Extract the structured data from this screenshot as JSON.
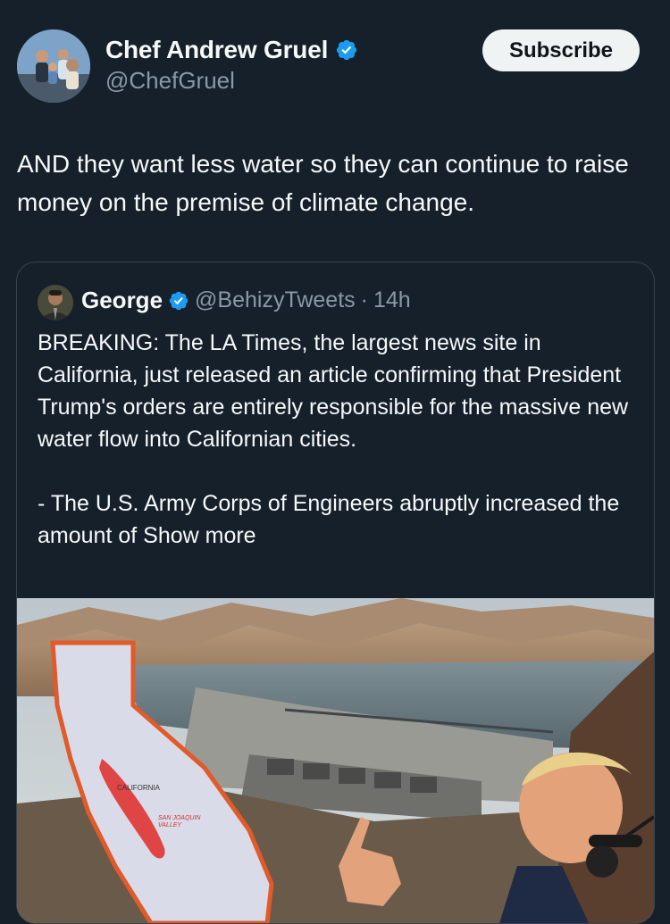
{
  "author": {
    "display_name": "Chef Andrew Gruel",
    "handle": "@ChefGruel",
    "avatar_icon": "family-photo-avatar",
    "verified": true
  },
  "subscribe_label": "Subscribe",
  "tweet": {
    "text": "AND they want less water so they can continue to raise money on the premise of climate change."
  },
  "quote": {
    "display_name": "George",
    "handle": "@BehizyTweets",
    "separator": "·",
    "time": "14h",
    "text": "BREAKING: The LA Times, the largest news site in California, just released an article confirming that President Trump's orders are entirely responsible for the massive new water flow into Californian cities.\n\n- The U.S. Army Corps of Engineers abruptly increased the amount of ",
    "show_more": "Show more",
    "image": {
      "map_label_state": "CALIFORNIA",
      "map_label_valley_line1": "SAN JOAQUIN",
      "map_label_valley_line2": "VALLEY"
    }
  },
  "colors": {
    "background": "#15202b",
    "text_primary": "#f7f9f9",
    "text_secondary": "#8b98a5",
    "verified_blue": "#1d9bf0",
    "border": "#38444d"
  }
}
